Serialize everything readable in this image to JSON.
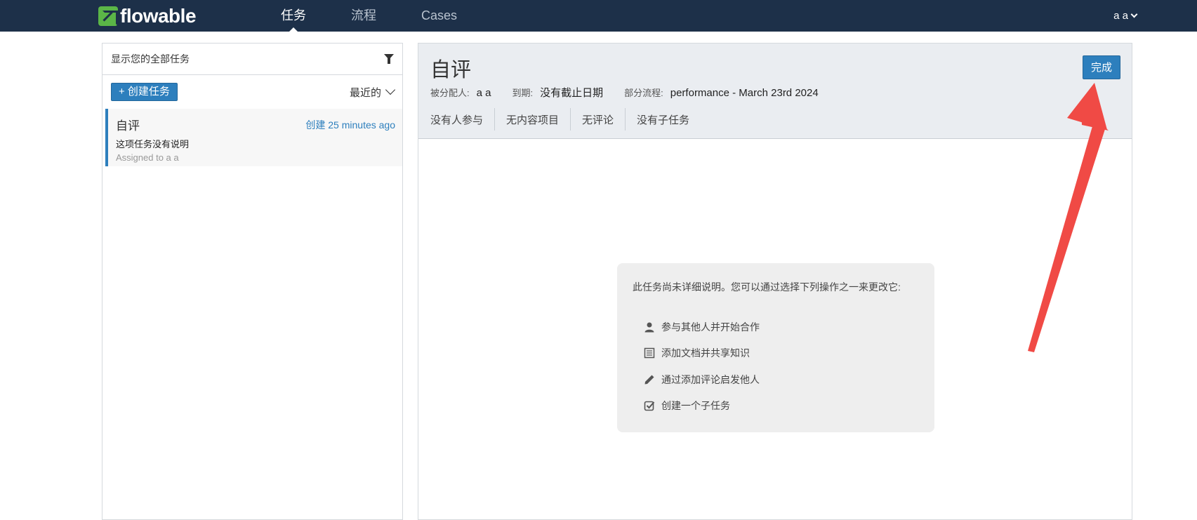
{
  "navbar": {
    "logo_text": "flowable",
    "items": [
      {
        "label": "任务",
        "active": true
      },
      {
        "label": "流程",
        "active": false
      },
      {
        "label": "Cases",
        "active": false
      }
    ],
    "user": "a a"
  },
  "task_list": {
    "filter_text": "显示您的全部任务",
    "create_button": "+ 创建任务",
    "sort_label": "最近的",
    "tasks": [
      {
        "title": "自评",
        "created": "创建 25 minutes ago",
        "description": "这项任务没有说明",
        "assigned": "Assigned to a a"
      }
    ]
  },
  "task_detail": {
    "title": "自评",
    "complete_button": "完成",
    "assignee_label": "被分配人:",
    "assignee_value": "a a",
    "due_label": "到期:",
    "due_value": "没有截止日期",
    "process_label": "部分流程:",
    "process_value": "performance - March 23rd 2024",
    "tabs": [
      "没有人参与",
      "无内容项目",
      "无评论",
      "没有子任务"
    ]
  },
  "help": {
    "intro": "此任务尚未详细说明。您可以通过选择下列操作之一来更改它:",
    "items": [
      {
        "icon": "user-icon",
        "label": "参与其他人并开始合作"
      },
      {
        "icon": "document-icon",
        "label": "添加文档并共享知识"
      },
      {
        "icon": "pencil-icon",
        "label": "通过添加评论启发他人"
      },
      {
        "icon": "checkbox-icon",
        "label": "创建一个子任务"
      }
    ]
  },
  "colors": {
    "navbar_bg": "#1d3049",
    "accent_blue": "#2d7fbd",
    "logo_green": "#5bb647",
    "annotation_red": "#f04a45"
  }
}
